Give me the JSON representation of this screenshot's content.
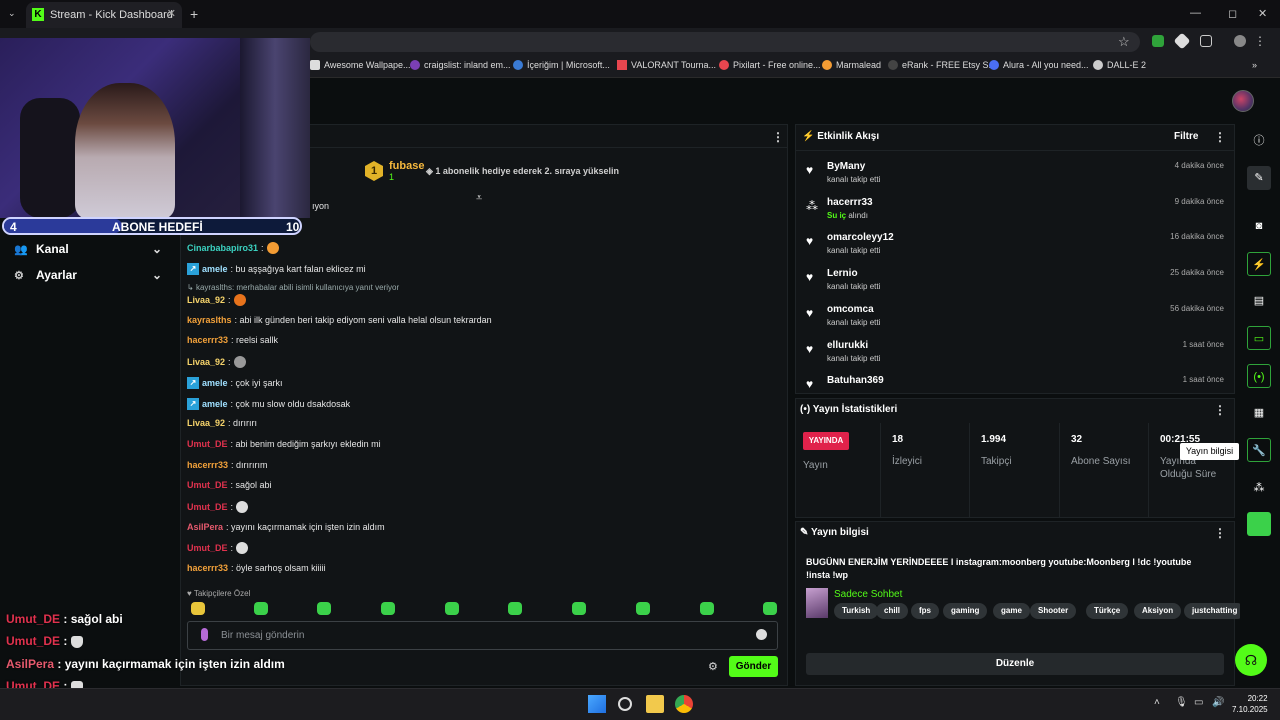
{
  "browser": {
    "tab_title": "Stream - Kick Dashboard",
    "bookmarks": [
      "Awesome Wallpape...",
      "craigslist: inland em...",
      "İçeriğim | Microsoft...",
      "VALORANT Tourna...",
      "Pixilart - Free online...",
      "Marmalead",
      "eRank - FREE Etsy S...",
      "Alura - All you need...",
      "DALL-E 2"
    ]
  },
  "goal": {
    "current": "4",
    "label": "ABONE HEDEFİ",
    "target": "10",
    "progress": 0.4
  },
  "nav": [
    {
      "label": "Kanal",
      "icon": "users-icon"
    },
    {
      "label": "Ayarlar",
      "icon": "gear-icon"
    }
  ],
  "overlay_chat": [
    {
      "user": "Umut_DE",
      "text": ": sağol abi"
    },
    {
      "user": "Umut_DE",
      "text": ":"
    },
    {
      "user": "AsilPera",
      "text": ": yayını kaçırmamak için işten izin aldım"
    },
    {
      "user": "Umut_DE",
      "text": ":"
    },
    {
      "user": "hacerrr33",
      "text": ": öyle sarhoş olsam kiiiii"
    }
  ],
  "chat": {
    "gifter_name": "fubase",
    "gifter_level": "1",
    "gifter_count": "1",
    "gifter_text": "1 abonelik hediye ederek 2. sıraya yükselin",
    "partial_top": "ıyon",
    "messages": [
      {
        "user": "hacerrr33",
        "text": ":",
        "color": "#f2a13a",
        "badge": false
      },
      {
        "user": "Cinarbabapiro31",
        "text": ":",
        "color": "#3bd1c0",
        "badge": false
      },
      {
        "user": "amele",
        "text": ": bu aşşağıya kart falan eklicez mi",
        "color": "#9fe0ff",
        "badge": true
      },
      {
        "user": "Livaa_92",
        "text": ":",
        "color": "#f5d36b",
        "badge": false
      },
      {
        "user": "kayraslths",
        "text": ": abi ilk günden beri takip ediyom seni valla helal olsun tekrardan",
        "color": "#f2a13a",
        "badge": false
      },
      {
        "user": "hacerrr33",
        "text": ": reelsi sallk",
        "color": "#f2a13a",
        "badge": false
      },
      {
        "user": "Livaa_92",
        "text": ":",
        "color": "#f5d36b",
        "badge": false
      },
      {
        "user": "amele",
        "text": ": çok iyi şarkı",
        "color": "#9fe0ff",
        "badge": true
      },
      {
        "user": "amele",
        "text": ": çok mu slow oldu dsakdosak",
        "color": "#9fe0ff",
        "badge": true
      },
      {
        "user": "Livaa_92",
        "text": ": dırırırı",
        "color": "#f5d36b",
        "badge": false
      },
      {
        "user": "Umut_DE",
        "text": ": abi benim dediğim şarkıyı ekledin mi",
        "color": "#e0324e",
        "badge": false
      },
      {
        "user": "hacerrr33",
        "text": ": dırırırım",
        "color": "#f2a13a",
        "badge": false
      },
      {
        "user": "Umut_DE",
        "text": ": sağol abi",
        "color": "#e0324e",
        "badge": false
      },
      {
        "user": "Umut_DE",
        "text": ":",
        "color": "#e0324e",
        "badge": false
      },
      {
        "user": "AsilPera",
        "text": ": yayını kaçırmamak için işten izin aldım",
        "color": "#e65a6e",
        "badge": false
      },
      {
        "user": "Umut_DE",
        "text": ":",
        "color": "#e0324e",
        "badge": false
      },
      {
        "user": "hacerrr33",
        "text": ": öyle sarhoş olsam kiiiii",
        "color": "#f2a13a",
        "badge": false
      }
    ],
    "reply_text": "kayraslths: merhabalar abili isimli kullanıcıya yanıt veriyor",
    "followers_only": "Takipçilere Özel",
    "input_placeholder": "Bir mesaj gönderin",
    "send_label": "Gönder"
  },
  "activity": {
    "title": "Etkinlik Akışı",
    "filter": "Filtre",
    "items": [
      {
        "name": "ByMany",
        "desc": "kanalı takip etti",
        "time": "4 dakika önce",
        "type": "follow"
      },
      {
        "name": "hacerrr33",
        "desc": "Su iç",
        "desc2": "alındı",
        "time": "9 dakika önce",
        "type": "reward"
      },
      {
        "name": "omarcoleyy12",
        "desc": "kanalı takip etti",
        "time": "16 dakika önce",
        "type": "follow"
      },
      {
        "name": "Lernio",
        "desc": "kanalı takip etti",
        "time": "25 dakika önce",
        "type": "follow"
      },
      {
        "name": "omcomca",
        "desc": "kanalı takip etti",
        "time": "56 dakika önce",
        "type": "follow"
      },
      {
        "name": "ellurukki",
        "desc": "kanalı takip etti",
        "time": "1 saat önce",
        "type": "follow"
      },
      {
        "name": "Batuhan369",
        "desc": "",
        "time": "1 saat önce",
        "type": "follow"
      }
    ]
  },
  "stats": {
    "title": "Yayın İstatistikleri",
    "live_label": "YAYINDA",
    "live_sub": "Yayın",
    "viewers": "18",
    "viewers_label": "İzleyici",
    "followers": "1.994",
    "followers_label": "Takipçi",
    "subs": "32",
    "subs_label": "Abone Sayısı",
    "duration": "00:21:55",
    "duration_label": "Yayında Olduğu Süre"
  },
  "info": {
    "title": "Yayın bilgisi",
    "stream_title": "BUGÜNN ENERJİM YERİNDEEEE l instagram:moonberg youtube:Moonberg l !dc !youtube !insta !wp",
    "category": "Sadece Sohbet",
    "tags": [
      "Turkish",
      "chill",
      "fps",
      "gaming",
      "game",
      "Shooter",
      "Türkçe",
      "Aksiyon",
      "justchatting"
    ],
    "edit_label": "Düzenle"
  },
  "tooltip": "Yayın bilgisi",
  "clock": {
    "time": "20:22",
    "date": "7.10.2025"
  },
  "colors": {
    "accent": "#53fc18",
    "live": "#e0224b",
    "bg": "#0b0e0f",
    "panel": "#111416"
  }
}
